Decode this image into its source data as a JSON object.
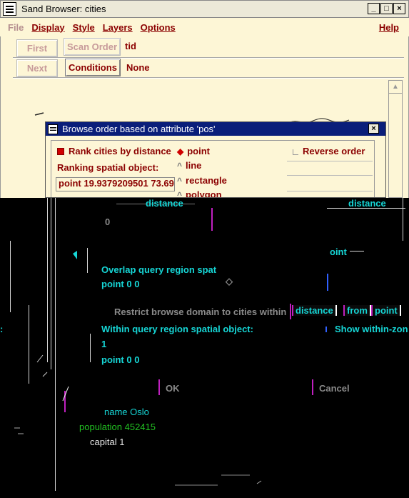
{
  "window": {
    "title": "Sand Browser: cities",
    "buttons": {
      "minimize": "_",
      "maximize": "□",
      "close": "×"
    }
  },
  "menubar": {
    "file": "File",
    "display": "Display",
    "style": "Style",
    "layers": "Layers",
    "options": "Options",
    "help": "Help"
  },
  "toolbar": {
    "first": "First",
    "scan_order": "Scan Order",
    "scan_order_value": "tid",
    "next": "Next",
    "conditions": "Conditions",
    "conditions_value": "None"
  },
  "dialog": {
    "title": "Browse order based on attribute 'pos'",
    "close": "×",
    "rank_label": "Rank cities by distance",
    "ranking_object_label": "Ranking spatial object:",
    "ranking_object_value": "point 19.9379209501 73.69",
    "shape_options": [
      "point",
      "line",
      "rectangle",
      "polygon"
    ],
    "selected_shape": "point",
    "reverse_order": "Reverse order"
  },
  "glitch": {
    "distance_1": "distance",
    "distance_2": "distance",
    "zero": "0",
    "point_frag": "oint",
    "overlap_label": "Overlap query region spat",
    "overlap_value": "point 0 0",
    "restrict_label": "Restrict browse domain to cities within",
    "restrict_distance": "distance",
    "restrict_from": "from",
    "restrict_point": "point",
    "within_label": "Within query region spatial object:",
    "show_within": "Show within-zon",
    "one": "1",
    "within_value": "point 0 0",
    "ok": "OK",
    "cancel": "Cancel",
    "name_field": "name  Oslo",
    "population_field": "population  452415",
    "capital_field": "capital  1",
    "colon": ":"
  }
}
